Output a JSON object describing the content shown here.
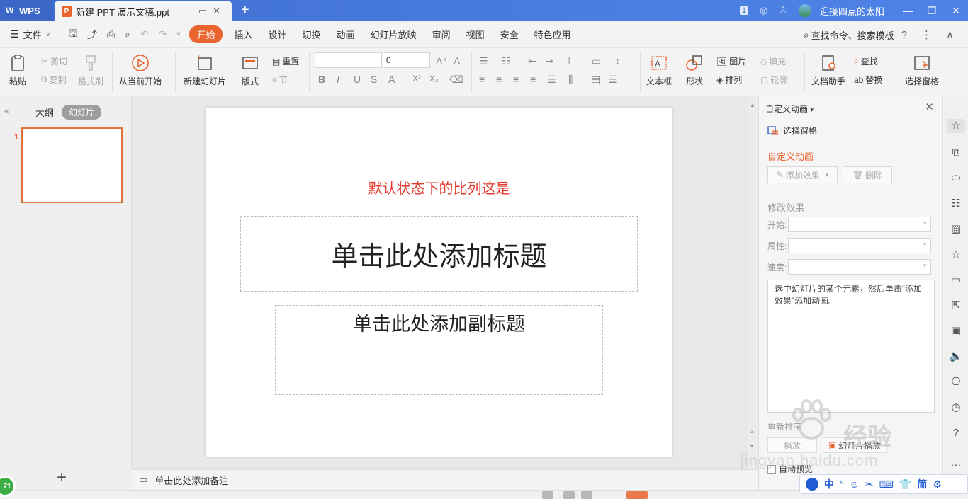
{
  "window": {
    "app_tab": "WPS",
    "doc_tab": "新建 PPT 演示文稿.ppt",
    "user_name": "迎接四点的太阳",
    "page_indicator": "1"
  },
  "menubar": {
    "file_label": "文件",
    "tabs": [
      "开始",
      "插入",
      "设计",
      "切换",
      "动画",
      "幻灯片放映",
      "审阅",
      "视图",
      "安全",
      "特色应用"
    ],
    "active_tab": "开始",
    "search_label": "查找命令、搜索模板"
  },
  "ribbon": {
    "paste": "粘贴",
    "cut": "剪切",
    "copy": "复制",
    "format_painter": "格式刷",
    "from_current": "从当前开始",
    "new_slide": "新建幻灯片",
    "layout": "版式",
    "reset": "重置",
    "section": "节",
    "font_name": "",
    "font_size": "0",
    "text_box": "文本框",
    "shape": "形状",
    "picture": "图片",
    "arrange": "排列",
    "fill": "填充",
    "outline": "轮廓",
    "doc_assistant": "文档助手",
    "find": "查找",
    "replace": "替换",
    "select_pane": "选择窗格"
  },
  "left_panel": {
    "tab_outline": "大纲",
    "tab_slides": "幻灯片",
    "slide_number": "1"
  },
  "slide": {
    "red_note": "默认状态下的比列这是",
    "title_placeholder": "单击此处添加标题",
    "subtitle_placeholder": "单击此处添加副标题"
  },
  "notes": {
    "placeholder": "单击此处添加备注"
  },
  "anim_pane": {
    "title": "自定义动画",
    "select_pane": "选择窗格",
    "heading": "自定义动画",
    "add_effect": "添加效果",
    "delete": "删除",
    "modify_heading": "修改效果",
    "start_label": "开始:",
    "property_label": "属性:",
    "speed_label": "速度:",
    "hint": "选中幻灯片的某个元素，然后单击“添加效果”添加动画。",
    "reorder_label": "重新排序",
    "play": "幻灯片播放",
    "play_prefix": "播放",
    "auto_preview": "自动预览"
  },
  "ime_bar": {
    "items": [
      "中",
      "°",
      "☺",
      "✂",
      "⌨",
      "简",
      "⚙"
    ]
  },
  "status": {
    "badge": "71"
  },
  "watermark": {
    "brand": "经验",
    "url": "jingyan.baidu.com"
  },
  "colors": {
    "accent": "#e8632e",
    "titlebar": "#4a7de0",
    "red_note": "#e23b2e"
  }
}
